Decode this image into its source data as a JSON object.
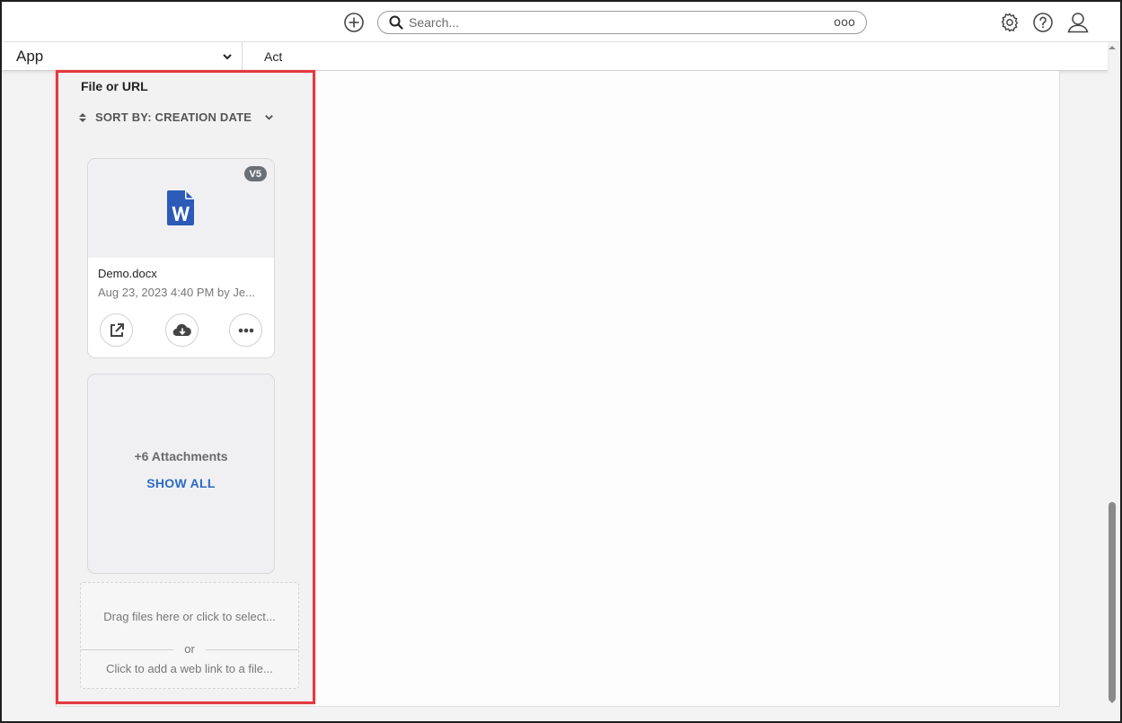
{
  "header": {
    "add_icon": "plus-circle-icon",
    "search": {
      "placeholder": "Search...",
      "more_label": "ooo"
    },
    "settings_icon": "gear-icon",
    "help_icon": "question-circle-icon",
    "user_icon": "user-icon"
  },
  "subbar": {
    "app_label": "App",
    "tab_label": "Act"
  },
  "attachments": {
    "field_title": "File or URL",
    "sort_label": "SORT BY: CREATION DATE",
    "file": {
      "version": "V5",
      "icon": "word-document-icon",
      "name": "Demo.docx",
      "meta": "Aug 23, 2023 4:40 PM by Je...",
      "actions": [
        "open-external-icon",
        "cloud-download-icon",
        "more-horizontal-icon"
      ]
    },
    "more": {
      "count_label": "+6 Attachments",
      "show_all_label": "SHOW ALL"
    },
    "drop_zone": {
      "drag_label": "Drag files here or click to select...",
      "or_label": "or",
      "web_link_label": "Click to add a web link to a file..."
    }
  },
  "colors": {
    "highlight_border": "#e23a3f",
    "link_blue": "#2d6bc4",
    "word_blue": "#2b5ab8",
    "badge_gray": "#6b6f76"
  }
}
